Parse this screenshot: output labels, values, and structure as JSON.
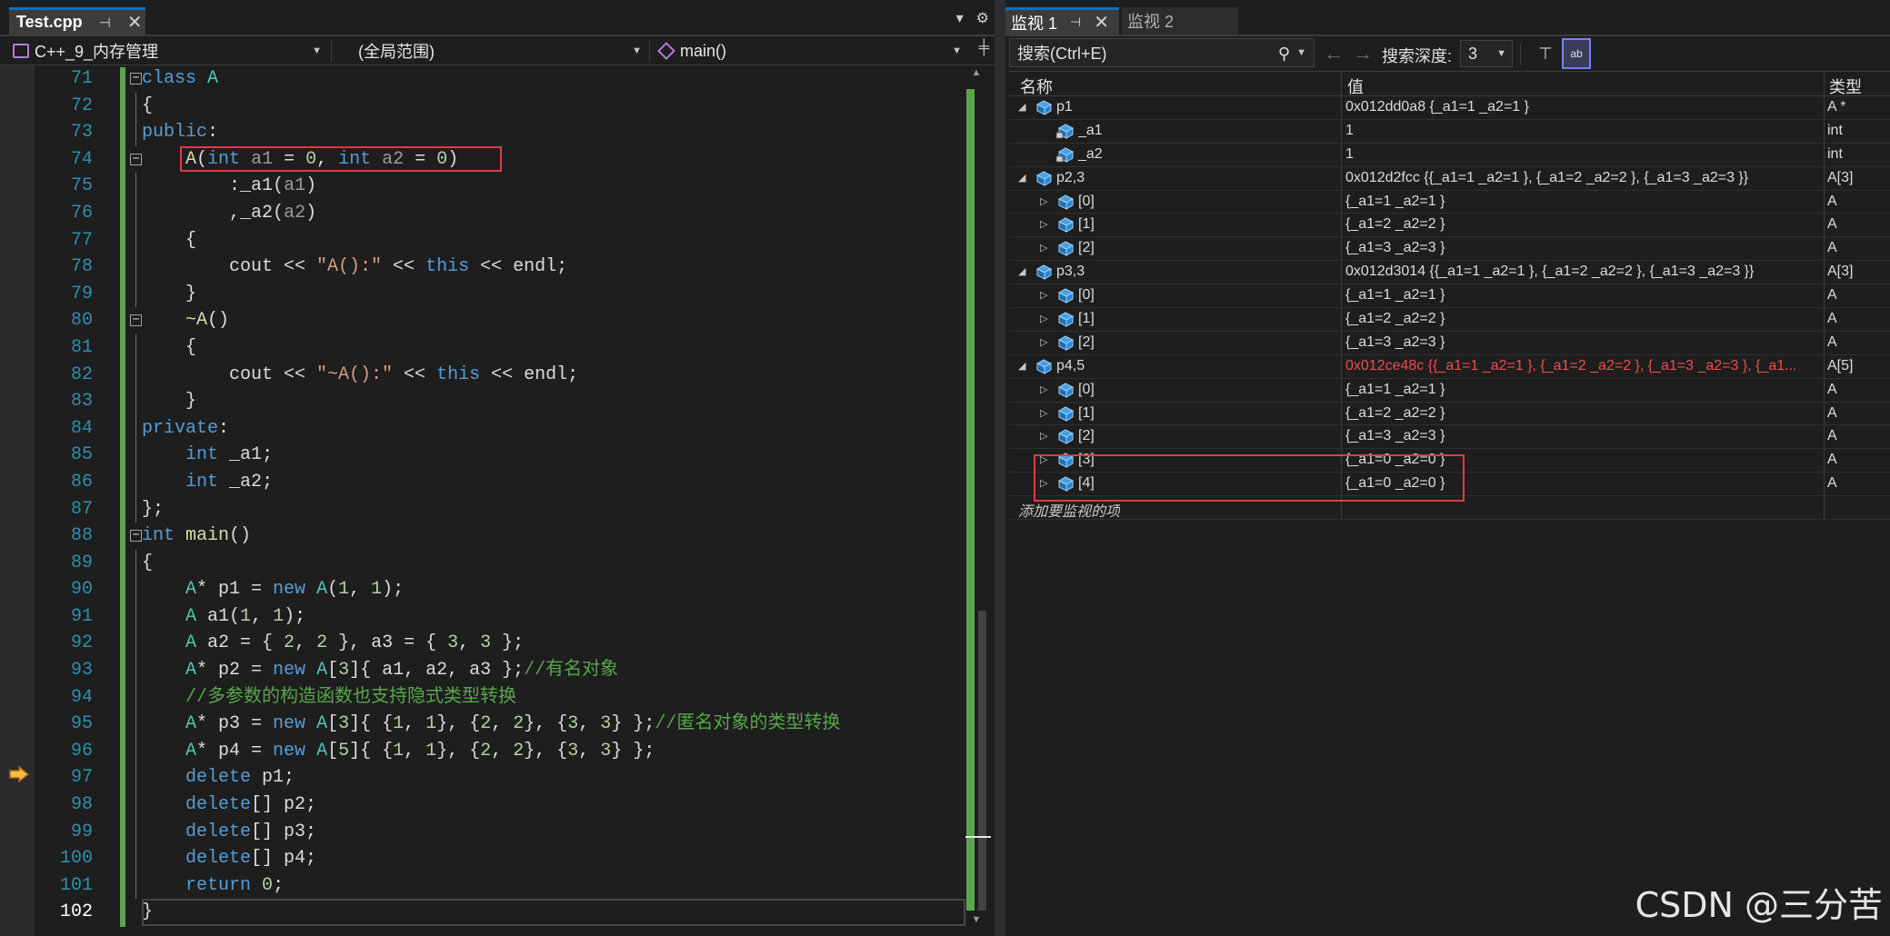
{
  "editor": {
    "tab_title": "Test.cpp",
    "project": "C++_9_内存管理",
    "scope": "(全局范围)",
    "member": "main()",
    "line_numbers": [
      "71",
      "72",
      "73",
      "74",
      "75",
      "76",
      "77",
      "78",
      "79",
      "80",
      "81",
      "82",
      "83",
      "84",
      "85",
      "86",
      "87",
      "88",
      "89",
      "90",
      "91",
      "92",
      "93",
      "94",
      "95",
      "96",
      "97",
      "98",
      "99",
      "100",
      "101",
      "102"
    ],
    "current_line": "102",
    "execution_line": "97"
  },
  "watch": {
    "tab1": "监视 1",
    "tab2": "监视 2",
    "search_placeholder": "搜索(Ctrl+E)",
    "depth_label": "搜索深度:",
    "depth_value": "3",
    "columns": {
      "name": "名称",
      "value": "值",
      "type": "类型"
    },
    "rows": [
      {
        "name": "p1",
        "value": "0x012dd0a8 {_a1=1 _a2=1 }",
        "type": "A *"
      },
      {
        "name": "_a1",
        "value": "1",
        "type": "int"
      },
      {
        "name": "_a2",
        "value": "1",
        "type": "int"
      },
      {
        "name": "p2,3",
        "value": "0x012d2fcc {{_a1=1 _a2=1 }, {_a1=2 _a2=2 }, {_a1=3 _a2=3 }}",
        "type": "A[3]"
      },
      {
        "name": "[0]",
        "value": "{_a1=1 _a2=1 }",
        "type": "A"
      },
      {
        "name": "[1]",
        "value": "{_a1=2 _a2=2 }",
        "type": "A"
      },
      {
        "name": "[2]",
        "value": "{_a1=3 _a2=3 }",
        "type": "A"
      },
      {
        "name": "p3,3",
        "value": "0x012d3014 {{_a1=1 _a2=1 }, {_a1=2 _a2=2 }, {_a1=3 _a2=3 }}",
        "type": "A[3]"
      },
      {
        "name": "[0]",
        "value": "{_a1=1 _a2=1 }",
        "type": "A"
      },
      {
        "name": "[1]",
        "value": "{_a1=2 _a2=2 }",
        "type": "A"
      },
      {
        "name": "[2]",
        "value": "{_a1=3 _a2=3 }",
        "type": "A"
      },
      {
        "name": "p4,5",
        "value": "0x012ce48c {{_a1=1 _a2=1 }, {_a1=2 _a2=2 }, {_a1=3 _a2=3 }, {_a1...",
        "type": "A[5]"
      },
      {
        "name": "[0]",
        "value": "{_a1=1 _a2=1 }",
        "type": "A"
      },
      {
        "name": "[1]",
        "value": "{_a1=2 _a2=2 }",
        "type": "A"
      },
      {
        "name": "[2]",
        "value": "{_a1=3 _a2=3 }",
        "type": "A"
      },
      {
        "name": "[3]",
        "value": "{_a1=0 _a2=0 }",
        "type": "A"
      },
      {
        "name": "[4]",
        "value": "{_a1=0 _a2=0 }",
        "type": "A"
      }
    ],
    "add_item": "添加要监视的项"
  },
  "watermark": "CSDN @三分苦",
  "colors": {
    "accent": "#0e70c0",
    "highlight_box": "#e03c3c",
    "change_bar": "#57a64a",
    "changed_value": "#f14c4c"
  },
  "icons": [
    "pin-icon",
    "close-icon",
    "dropdown-arrow-icon",
    "settings-gear-icon",
    "split-icon",
    "project-icon",
    "member-cube-icon",
    "fold-collapse-icon",
    "execution-arrow-icon",
    "search-icon",
    "back-arrow-icon",
    "forward-arrow-icon",
    "pin-to-source-icon",
    "hex-display-icon",
    "expand-triangle-icon",
    "collapse-triangle-icon",
    "object-icon",
    "private-field-icon"
  ]
}
